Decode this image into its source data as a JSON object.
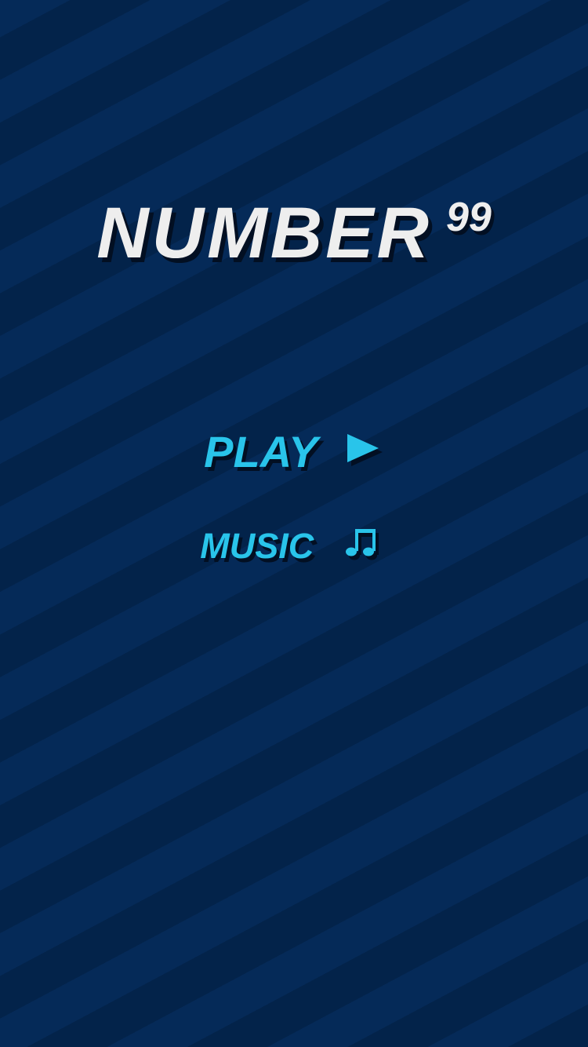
{
  "game": {
    "title": "NUMBER",
    "title_superscript": "99"
  },
  "menu": {
    "play_label": "PLAY",
    "play_icon": "play-triangle-icon",
    "music_label": "MUSIC",
    "music_icon": "music-notes-icon"
  },
  "colors": {
    "background": "#03234a",
    "background_stripe": "#052a58",
    "title_text": "#eeeeee",
    "menu_text": "#29c4ea",
    "shadow": "#020f22"
  }
}
